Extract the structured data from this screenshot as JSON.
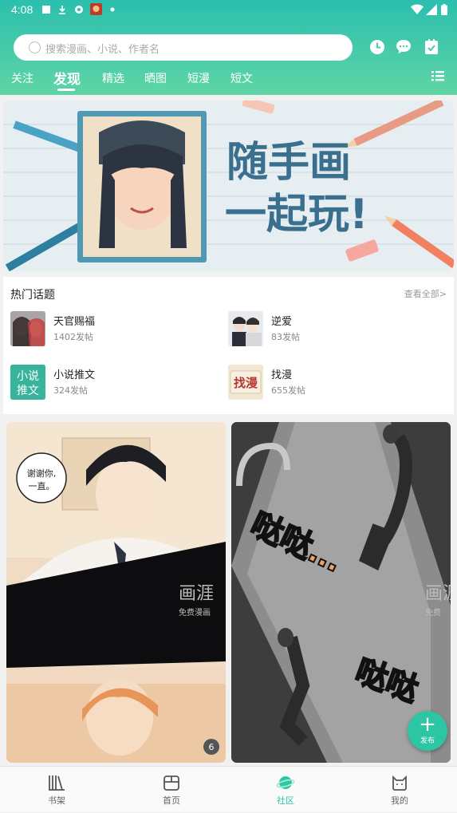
{
  "status_bar": {
    "time": "4:08"
  },
  "search": {
    "placeholder": "搜索漫画、小说、作者名"
  },
  "tabs": [
    {
      "label": "关注"
    },
    {
      "label": "发现",
      "active": true
    },
    {
      "label": "精选"
    },
    {
      "label": "晒图"
    },
    {
      "label": "短漫"
    },
    {
      "label": "短文"
    }
  ],
  "banner": {
    "text_line1": "随手画",
    "text_line2": "一起玩!"
  },
  "hot_topics": {
    "title": "热门话题",
    "view_all": "查看全部>",
    "items": [
      {
        "name": "天官赐福",
        "count": "1402发帖"
      },
      {
        "name": "逆爱",
        "count": "83发帖"
      },
      {
        "name": "小说推文",
        "count": "324发帖",
        "thumb_text": [
          "小说",
          "推文"
        ]
      },
      {
        "name": "找漫",
        "count": "655发帖",
        "thumb_text": "找漫"
      }
    ]
  },
  "cards": [
    {
      "bubble": [
        "谢谢你,",
        "一直。"
      ],
      "watermark": "画涯",
      "watermark_sub": "免费漫画",
      "badge": "6"
    },
    {
      "sfx1": "哒哒…",
      "sfx2": "哒哒",
      "watermark": "画涯",
      "watermark_sub": "免费"
    }
  ],
  "fab": {
    "label": "发布"
  },
  "bottom_nav": [
    {
      "label": "书架"
    },
    {
      "label": "首页"
    },
    {
      "label": "社区",
      "active": true
    },
    {
      "label": "我的"
    }
  ],
  "colors": {
    "accent": "#2cc6a4",
    "header_top": "#2bbfae",
    "header_bottom": "#5fd5a6"
  }
}
